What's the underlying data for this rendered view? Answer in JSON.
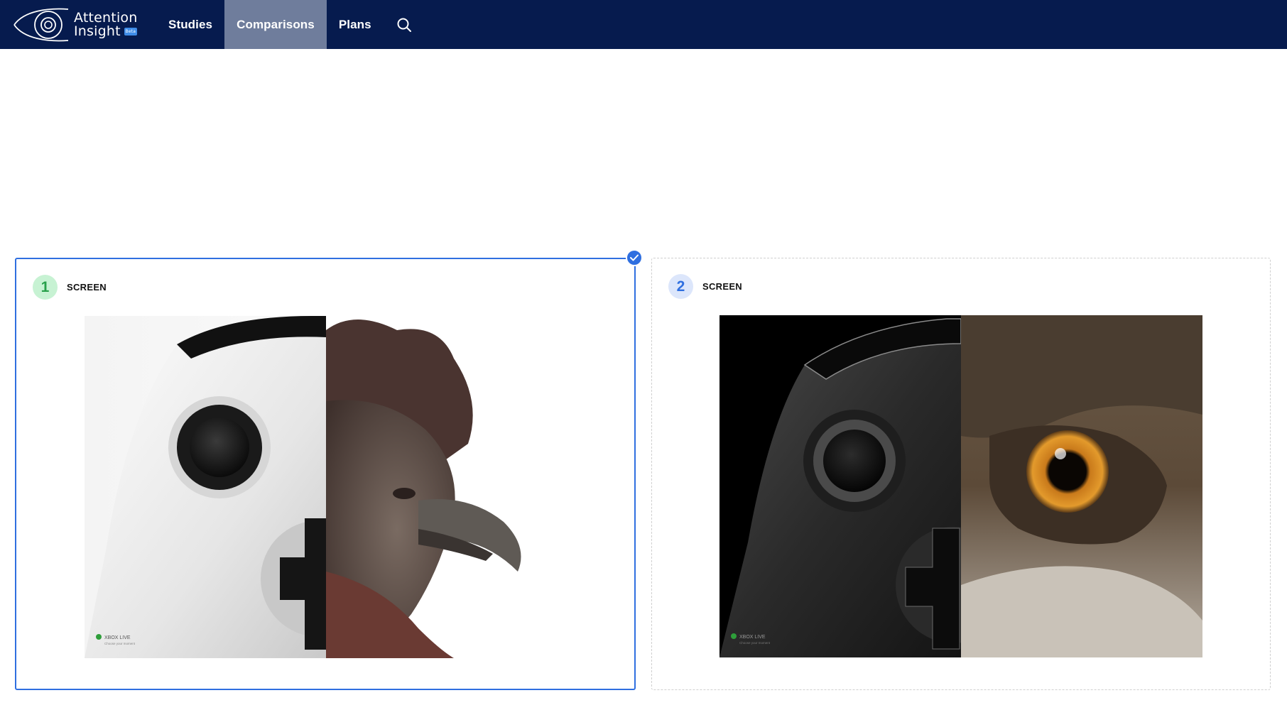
{
  "nav": {
    "logo_line1": "Attention",
    "logo_line2": "Insight",
    "logo_badge": "Beta",
    "items": [
      {
        "label": "Studies",
        "active": false
      },
      {
        "label": "Comparisons",
        "active": true
      },
      {
        "label": "Plans",
        "active": false
      }
    ],
    "search_icon": "search-icon"
  },
  "comparison": {
    "cards": [
      {
        "number": "1",
        "label": "SCREEN",
        "selected": true,
        "badge_color": "#27a04a",
        "image": "white game controller half joined with rooster head",
        "footer_brand": "XBOX LIVE",
        "footer_tagline": "Choose your moment"
      },
      {
        "number": "2",
        "label": "SCREEN",
        "selected": false,
        "badge_color": "#2f6fe0",
        "image": "black game controller half joined with owl face",
        "footer_brand": "XBOX LIVE",
        "footer_tagline": "Choose your moment"
      }
    ]
  },
  "colors": {
    "nav_bg": "#061b4e",
    "nav_active": "#6f7d9c",
    "selected_border": "#2f6fe0"
  }
}
